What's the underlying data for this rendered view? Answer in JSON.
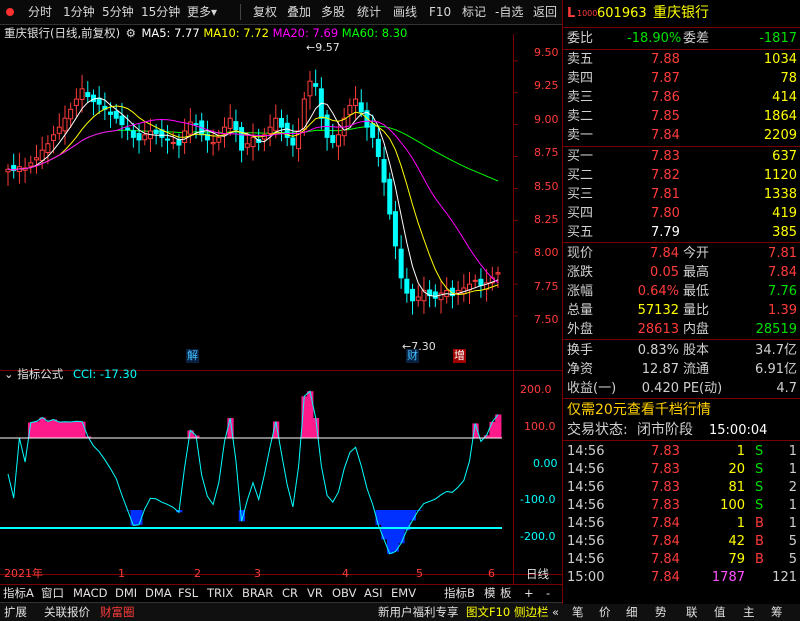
{
  "toolbar": {
    "tabs": [
      "分时",
      "1分钟",
      "5分钟",
      "15分钟",
      "更多"
    ],
    "more_arrow": "▾",
    "actions": [
      "复权",
      "叠加",
      "多股",
      "统计",
      "画线",
      "F10",
      "标记",
      "-自选",
      "返回"
    ]
  },
  "header": {
    "stock_name": "重庆银行",
    "chart_mode": "(日线,前复权)",
    "ma5": "MA5: 7.77",
    "ma10": "MA10: 7.72",
    "ma20": "MA20: 7.69",
    "ma60": "MA60: 8.30"
  },
  "price_axis": [
    "9.50",
    "9.25",
    "9.00",
    "8.75",
    "8.50",
    "8.25",
    "8.00",
    "7.75",
    "7.50"
  ],
  "annotations": {
    "high": "9.57",
    "low": "7.30",
    "mark_jie": "解",
    "mark_cai": "财",
    "mark_zeng": "增"
  },
  "indicator": {
    "title": "指标公式",
    "cci_label": "CCI: -17.30",
    "axis": [
      "200.0",
      "100.0",
      "0.00",
      "-100.0",
      "-200.0"
    ]
  },
  "time_axis": {
    "year": "2021年",
    "months": [
      "1",
      "2",
      "3",
      "4",
      "5",
      "6"
    ],
    "period": "日线"
  },
  "indicator_tabs": [
    "指标A",
    "窗口",
    "MACD",
    "DMI",
    "DMA",
    "FSL",
    "TRIX",
    "BRAR",
    "CR",
    "VR",
    "OBV",
    "ASI",
    "EMV"
  ],
  "indicator_tabs_right": [
    "指标B",
    "模",
    "板",
    "+",
    "-"
  ],
  "bottom_tabs": [
    "扩展",
    "关联报价",
    "财富圈"
  ],
  "bottom_right": {
    "promo": "新用户福利专享",
    "f10": "图文F10",
    "sidebar": "侧边栏"
  },
  "bottom_right_arrows": "«",
  "right_tabs": [
    "笔",
    "价",
    "细",
    "势",
    "联",
    "值",
    "主",
    "筹"
  ],
  "quote": {
    "code": "601963",
    "name": "重庆银行",
    "flag": "L",
    "flag_sub": "1000",
    "weibi_label": "委比",
    "weibi": "-18.90%",
    "weicha_label": "委差",
    "weicha": "-1817",
    "sells": [
      {
        "label": "卖五",
        "price": "7.88",
        "vol": "1034"
      },
      {
        "label": "卖四",
        "price": "7.87",
        "vol": "78"
      },
      {
        "label": "卖三",
        "price": "7.86",
        "vol": "414"
      },
      {
        "label": "卖二",
        "price": "7.85",
        "vol": "1864"
      },
      {
        "label": "卖一",
        "price": "7.84",
        "vol": "2209"
      }
    ],
    "buys": [
      {
        "label": "买一",
        "price": "7.83",
        "vol": "637"
      },
      {
        "label": "买二",
        "price": "7.82",
        "vol": "1120"
      },
      {
        "label": "买三",
        "price": "7.81",
        "vol": "1338"
      },
      {
        "label": "买四",
        "price": "7.80",
        "vol": "419"
      },
      {
        "label": "买五",
        "price": "7.79",
        "vol": "385"
      }
    ],
    "stats": [
      {
        "l1": "现价",
        "v1": "7.84",
        "l2": "今开",
        "v2": "7.81"
      },
      {
        "l1": "涨跌",
        "v1": "0.05",
        "l2": "最高",
        "v2": "7.84"
      },
      {
        "l1": "涨幅",
        "v1": "0.64%",
        "l2": "最低",
        "v2": "7.76"
      },
      {
        "l1": "总量",
        "v1": "57132",
        "l2": "量比",
        "v2": "1.39"
      },
      {
        "l1": "外盘",
        "v1": "28613",
        "l2": "内盘",
        "v2": "28519"
      }
    ],
    "fin": [
      {
        "l1": "换手",
        "v1": "0.83%",
        "l2": "股本",
        "v2": "34.7亿"
      },
      {
        "l1": "净资",
        "v1": "12.87",
        "l2": "流通",
        "v2": "6.91亿"
      },
      {
        "l1": "收益(一)",
        "v1": "0.420",
        "l2": "PE(动)",
        "v2": "4.7"
      }
    ],
    "promo": "仅需20元查看千档行情",
    "status_label": "交易状态:",
    "status": "闭市阶段",
    "status_time": "15:00:04",
    "ticks": [
      {
        "t": "14:56",
        "p": "7.83",
        "v": "1",
        "s": "S",
        "n": "1"
      },
      {
        "t": "14:56",
        "p": "7.83",
        "v": "20",
        "s": "S",
        "n": "1"
      },
      {
        "t": "14:56",
        "p": "7.83",
        "v": "81",
        "s": "S",
        "n": "2"
      },
      {
        "t": "14:56",
        "p": "7.83",
        "v": "100",
        "s": "S",
        "n": "1"
      },
      {
        "t": "14:56",
        "p": "7.84",
        "v": "1",
        "s": "B",
        "n": "1"
      },
      {
        "t": "14:56",
        "p": "7.84",
        "v": "42",
        "s": "B",
        "n": "5"
      },
      {
        "t": "14:56",
        "p": "7.84",
        "v": "79",
        "s": "B",
        "n": "5"
      },
      {
        "t": "15:00",
        "p": "7.84",
        "v": "1787",
        "s": "",
        "n": "121"
      }
    ]
  },
  "chart_data": {
    "type": "candlestick",
    "price_range": [
      7.3,
      9.57
    ],
    "closes": [
      8.65,
      8.64,
      8.67,
      8.66,
      8.7,
      8.74,
      8.8,
      8.85,
      8.92,
      8.98,
      9.05,
      9.12,
      9.2,
      9.28,
      9.22,
      9.18,
      9.16,
      9.12,
      9.08,
      9.05,
      9.0,
      8.96,
      8.9,
      8.88,
      8.92,
      8.95,
      8.93,
      8.9,
      8.88,
      8.86,
      8.84,
      8.95,
      9.02,
      9.0,
      8.92,
      8.88,
      8.86,
      8.9,
      8.98,
      9.05,
      8.96,
      8.8,
      8.85,
      8.9,
      8.86,
      8.92,
      8.98,
      9.05,
      8.98,
      8.9,
      8.84,
      8.95,
      9.2,
      9.34,
      9.3,
      9.05,
      8.9,
      8.86,
      8.92,
      9.05,
      9.15,
      9.2,
      9.1,
      8.98,
      8.9,
      8.75,
      8.55,
      8.3,
      8.05,
      7.8,
      7.68,
      7.62,
      7.65,
      7.7,
      7.66,
      7.64,
      7.68,
      7.7,
      7.66,
      7.7,
      7.72,
      7.75,
      7.78,
      7.74,
      7.76,
      7.8,
      7.84
    ],
    "cci_range": [
      -200,
      200
    ]
  },
  "colors": {
    "up": "#ff3c3c",
    "down": "#00ffff",
    "ma5": "#ffffff",
    "ma10": "#ffff00",
    "ma20": "#ff00ff",
    "ma60": "#00ff00"
  }
}
